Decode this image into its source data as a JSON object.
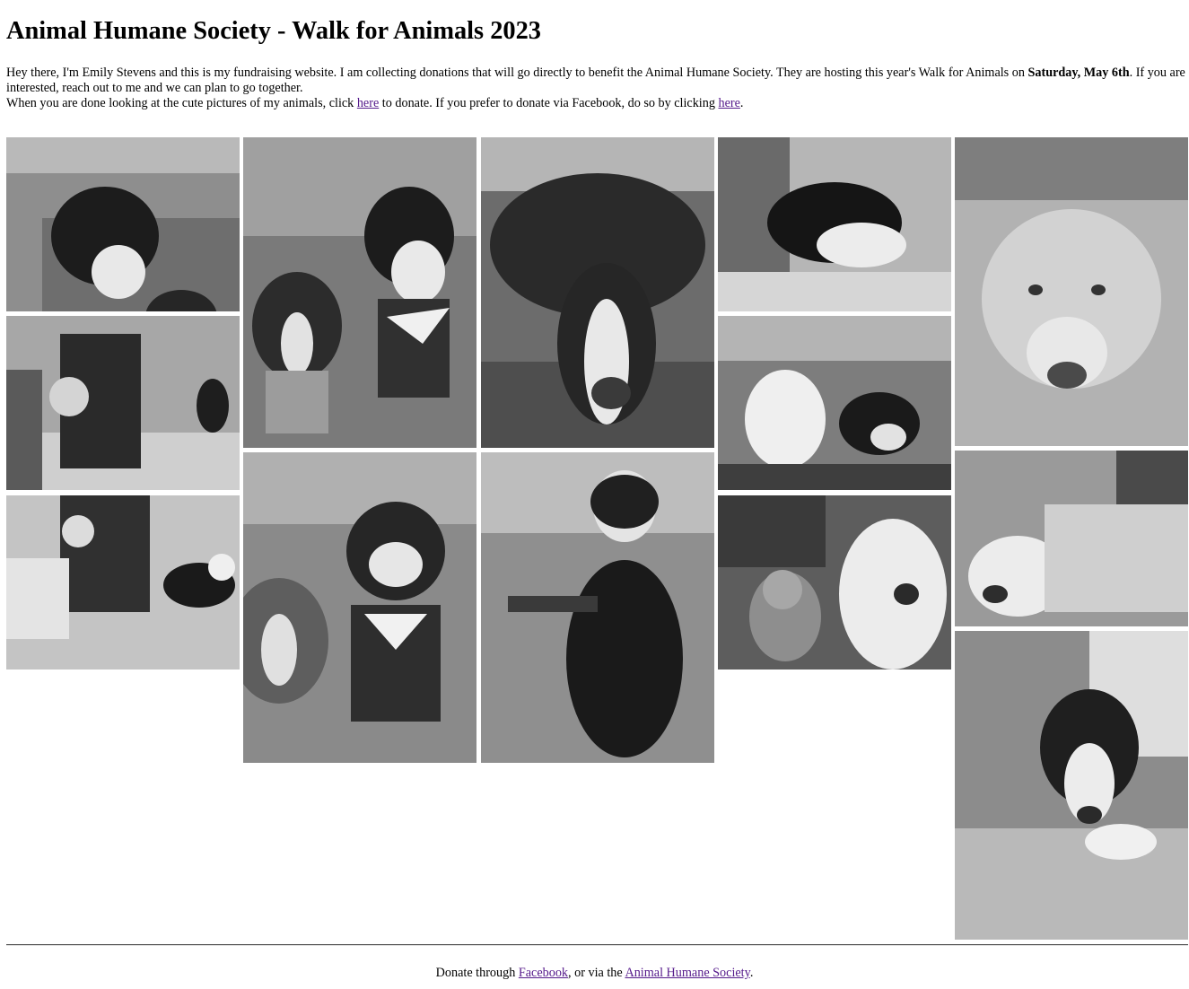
{
  "page": {
    "title": "Animal Humane Society - Walk for Animals 2023",
    "intro": {
      "text1": "Hey there, I'm Emily Stevens and this is my fundraising website. I am collecting donations that will go directly to benefit the Animal Humane Society. They are hosting this year's Walk for Animals on ",
      "event_date": "Saturday, May 6th",
      "text2": ". If you are interested, reach out to me and we can plan to go together.",
      "line2_text1": "When you are done looking at the cute pictures of my animals, click ",
      "donate_link": "here",
      "line2_text2": " to donate. If you prefer to donate via Facebook, do so by clicking ",
      "facebook_link": "here",
      "line2_end": "."
    },
    "gallery": {
      "photos": [
        {
          "subject": "two dogs resting in car back seat"
        },
        {
          "subject": "stroller and dog walking on path"
        },
        {
          "subject": "toddler in stroller with dog on leash"
        },
        {
          "subject": "two dogs sitting outdoors at walk"
        },
        {
          "subject": "two dogs smiling at walk"
        },
        {
          "subject": "dog with bandana lying in car"
        },
        {
          "subject": "dog in harness sitting on grass"
        },
        {
          "subject": "dog sleeping on blanket"
        },
        {
          "subject": "two dogs lying on blanket"
        },
        {
          "subject": "cat and dog on couch"
        },
        {
          "subject": "dog resting head on pillow"
        },
        {
          "subject": "dog sleeping under blanket"
        },
        {
          "subject": "dog lying on couch"
        }
      ]
    },
    "footer": {
      "text1": "Donate through ",
      "facebook_link": "Facebook",
      "text2": ", or via the ",
      "ahs_link": "Animal Humane Society",
      "text3": "."
    }
  }
}
